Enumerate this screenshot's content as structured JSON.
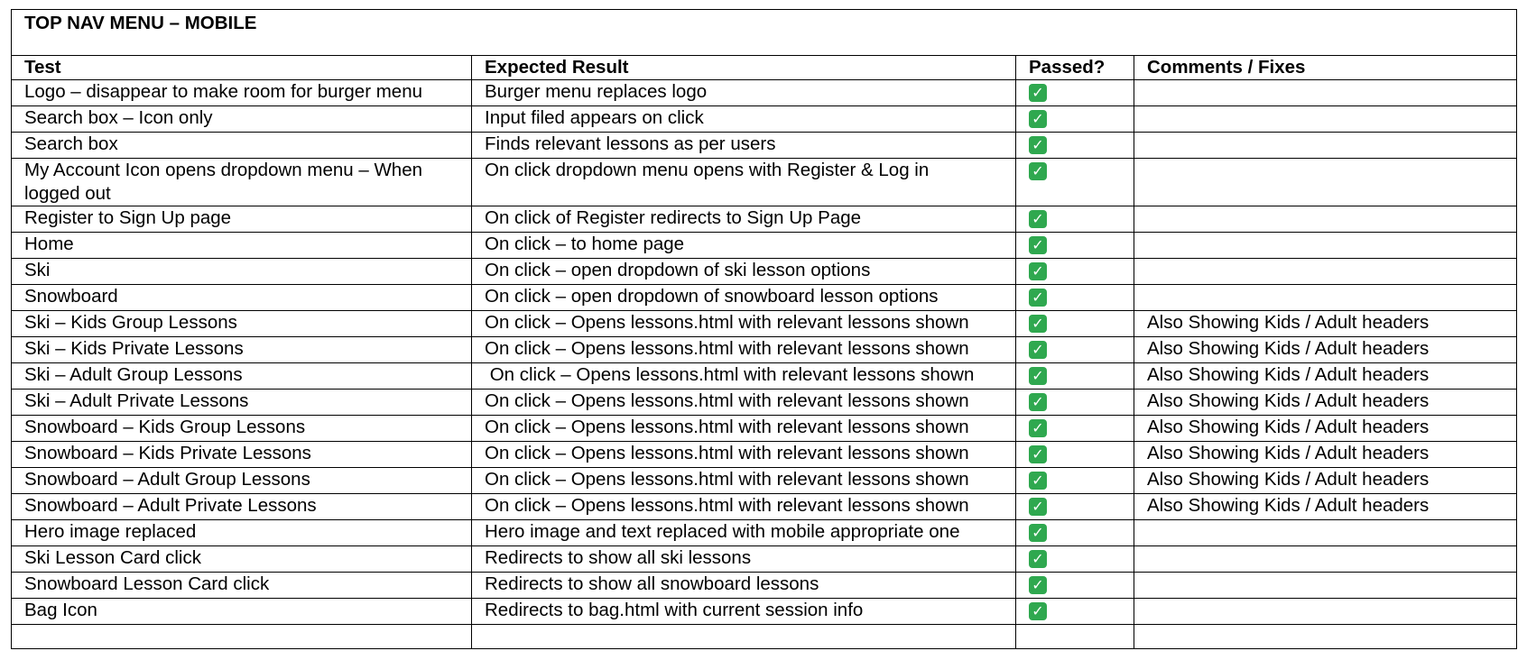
{
  "title": "TOP NAV MENU – MOBILE",
  "columns": [
    "Test",
    "Expected Result",
    "Passed?",
    "Comments / Fixes"
  ],
  "check_glyph": "✓",
  "check_color": "#2fa84f",
  "rows": [
    {
      "test": "Logo – disappear to make room for burger menu",
      "expected": "Burger menu replaces logo",
      "passed": true,
      "comment": ""
    },
    {
      "test": "Search box – Icon only",
      "expected": "Input filed appears on click",
      "passed": true,
      "comment": ""
    },
    {
      "test": "Search box",
      "expected": "Finds relevant lessons as per users",
      "passed": true,
      "comment": ""
    },
    {
      "test": "My Account Icon opens dropdown menu – When logged out",
      "expected": "On click dropdown menu opens with Register & Log in",
      "passed": true,
      "comment": ""
    },
    {
      "test": "Register to Sign Up page",
      "expected": "On click of Register redirects to Sign Up Page",
      "passed": true,
      "comment": ""
    },
    {
      "test": "Home",
      "expected": "On click – to home page",
      "passed": true,
      "comment": ""
    },
    {
      "test": "Ski",
      "expected": "On click – open dropdown of ski lesson options",
      "passed": true,
      "comment": ""
    },
    {
      "test": "Snowboard",
      "expected": "On click – open dropdown of snowboard lesson options",
      "passed": true,
      "comment": ""
    },
    {
      "test": "Ski – Kids Group Lessons",
      "expected": "On click – Opens lessons.html with relevant lessons shown",
      "passed": true,
      "comment": "Also Showing Kids / Adult headers"
    },
    {
      "test": "Ski – Kids Private Lessons",
      "expected": "On click – Opens lessons.html with relevant lessons shown",
      "passed": true,
      "comment": "Also Showing Kids / Adult headers"
    },
    {
      "test": "Ski – Adult Group Lessons",
      "expected": " On click – Opens lessons.html with relevant lessons shown",
      "passed": true,
      "comment": "Also Showing Kids / Adult headers"
    },
    {
      "test": "Ski – Adult Private Lessons",
      "expected": "On click – Opens lessons.html with relevant lessons shown",
      "passed": true,
      "comment": "Also Showing Kids / Adult headers"
    },
    {
      "test": "Snowboard – Kids Group Lessons",
      "expected": "On click – Opens lessons.html with relevant lessons shown",
      "passed": true,
      "comment": "Also Showing Kids / Adult headers"
    },
    {
      "test": "Snowboard – Kids Private Lessons",
      "expected": "On click – Opens lessons.html with relevant lessons shown",
      "passed": true,
      "comment": "Also Showing Kids / Adult headers"
    },
    {
      "test": "Snowboard – Adult Group Lessons",
      "expected": "On click – Opens lessons.html with relevant lessons shown",
      "passed": true,
      "comment": "Also Showing Kids / Adult headers"
    },
    {
      "test": "Snowboard – Adult Private Lessons",
      "expected": "On click – Opens lessons.html with relevant lessons shown",
      "passed": true,
      "comment": "Also Showing Kids / Adult headers"
    },
    {
      "test": "Hero image replaced",
      "expected": "Hero image and text replaced with mobile appropriate one",
      "passed": true,
      "comment": ""
    },
    {
      "test": "Ski Lesson Card click",
      "expected": "Redirects to show all ski lessons",
      "passed": true,
      "comment": ""
    },
    {
      "test": "Snowboard Lesson Card click",
      "expected": "Redirects to show all snowboard lessons",
      "passed": true,
      "comment": ""
    },
    {
      "test": "Bag Icon",
      "expected": "Redirects to bag.html with current session info",
      "passed": true,
      "comment": ""
    }
  ]
}
